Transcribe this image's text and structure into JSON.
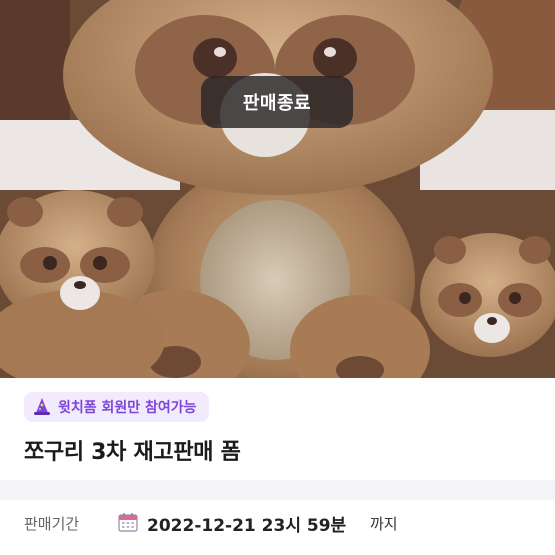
{
  "hero": {
    "image": "brown raccoon plush toys",
    "status_badge": "판매종료"
  },
  "member_tag": {
    "icon": "wizard-hat-icon",
    "label": "윗치폼 회원만 참여가능"
  },
  "product": {
    "title": "쪼구리 3차 재고판매 폼"
  },
  "sale_period": {
    "label": "판매기간",
    "icon": "calendar-icon",
    "date": "2022-12-21 23시 59분",
    "suffix": "까지"
  },
  "colors": {
    "accent": "#7c46d8",
    "tag_background": "#f2eafd",
    "badge_background": "#282424"
  }
}
